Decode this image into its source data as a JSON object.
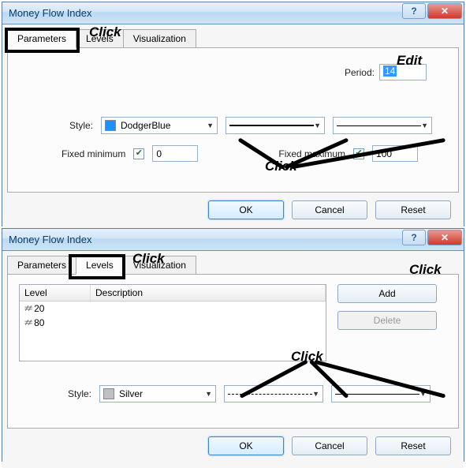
{
  "dialog1": {
    "title": "Money Flow Index",
    "tabs": {
      "parameters": "Parameters",
      "levels": "Levels",
      "visualization": "Visualization"
    },
    "period_label": "Period:",
    "period_value": "14",
    "style_label": "Style:",
    "style_color_name": "DodgerBlue",
    "fixed_min_label": "Fixed minimum",
    "fixed_min_value": "0",
    "fixed_max_label": "Fixed maximum",
    "fixed_max_value": "100",
    "buttons": {
      "ok": "OK",
      "cancel": "Cancel",
      "reset": "Reset"
    }
  },
  "dialog2": {
    "title": "Money Flow Index",
    "tabs": {
      "parameters": "Parameters",
      "levels": "Levels",
      "visualization": "Visualization"
    },
    "list": {
      "header_level": "Level",
      "header_desc": "Description",
      "rows": [
        {
          "value": "20",
          "desc": ""
        },
        {
          "value": "80",
          "desc": ""
        }
      ]
    },
    "add": "Add",
    "delete": "Delete",
    "style_label": "Style:",
    "style_color_name": "Silver",
    "buttons": {
      "ok": "OK",
      "cancel": "Cancel",
      "reset": "Reset"
    }
  },
  "annotations": {
    "click": "Click",
    "edit": "Edit"
  }
}
